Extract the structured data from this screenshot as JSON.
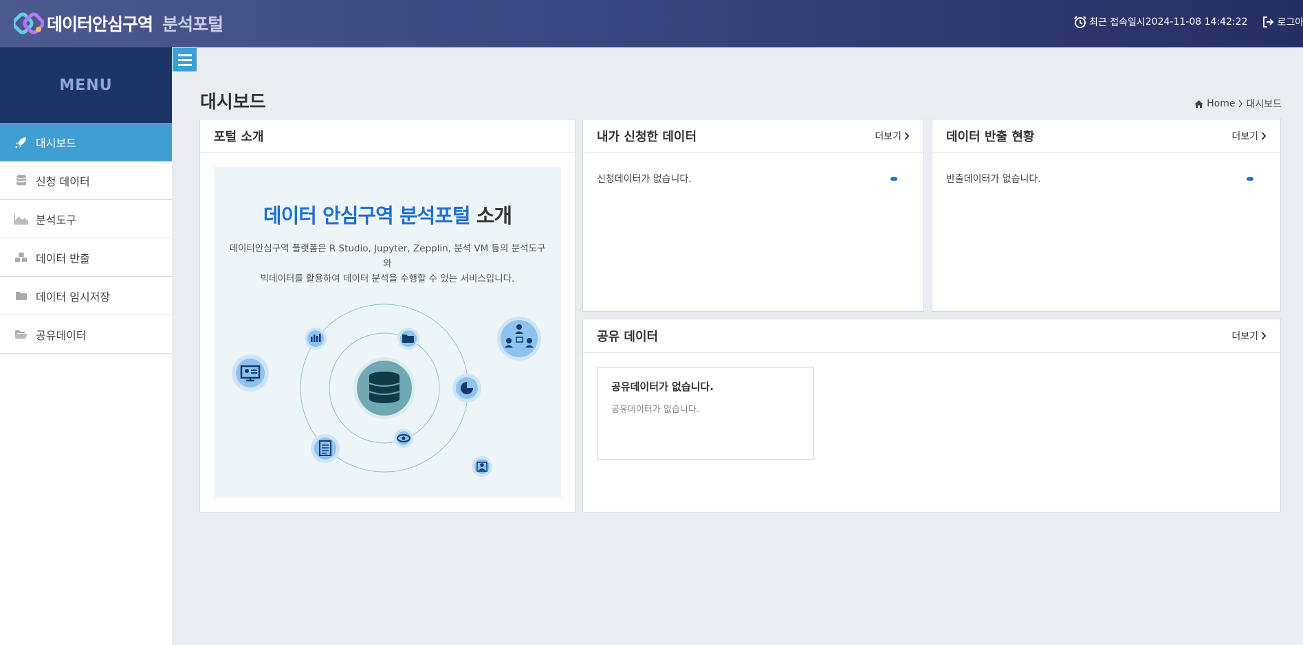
{
  "header": {
    "title": "데이터안심구역",
    "subtitle": "분석포털",
    "last_login_label": "최근 접속일시",
    "last_login_value": "2024-11-08 14:42:22",
    "logout_label": "로그아웃"
  },
  "sidebar": {
    "menu_title": "MENU",
    "items": [
      {
        "label": "대시보드",
        "icon": "rocket-icon",
        "active": true
      },
      {
        "label": "신청 데이터",
        "icon": "database-icon"
      },
      {
        "label": "분석도구",
        "icon": "area-chart-icon"
      },
      {
        "label": "데이터 반출",
        "icon": "cubes-icon"
      },
      {
        "label": "데이터 임시저장",
        "icon": "folder-icon"
      },
      {
        "label": "공유데이터",
        "icon": "folder-open-icon"
      }
    ]
  },
  "page": {
    "title": "대시보드",
    "breadcrumb": {
      "home": "Home",
      "current": "대시보드"
    }
  },
  "panels": {
    "intro": {
      "title": "포털 소개",
      "heading_blue_1": "데이터 안심구역",
      "heading_blue_2": "분석포털",
      "heading_dark": "소개",
      "desc_line1": "데이터안심구역 플랫폼은 R Studio, Jupyter, Zepplin, 분석 VM 등의 분석도구와",
      "desc_line2": "빅데이터를 활용하여 데이터 분석을 수행할 수 있는 서비스입니다."
    },
    "my_data": {
      "title": "내가 신청한 데이터",
      "more": "더보기",
      "empty": "신청데이터가 없습니다."
    },
    "export": {
      "title": "데이터 반출 현황",
      "more": "더보기",
      "empty": "반출데이터가 없습니다."
    },
    "shared": {
      "title": "공유 데이터",
      "more": "더보기",
      "card_title": "공유데이터가 없습니다.",
      "card_desc": "공유데이터가 없습니다."
    }
  },
  "colors": {
    "accent": "#3f9fd3",
    "brand_blue": "#1d6fd0",
    "sidebar_head": "#1d3466"
  }
}
